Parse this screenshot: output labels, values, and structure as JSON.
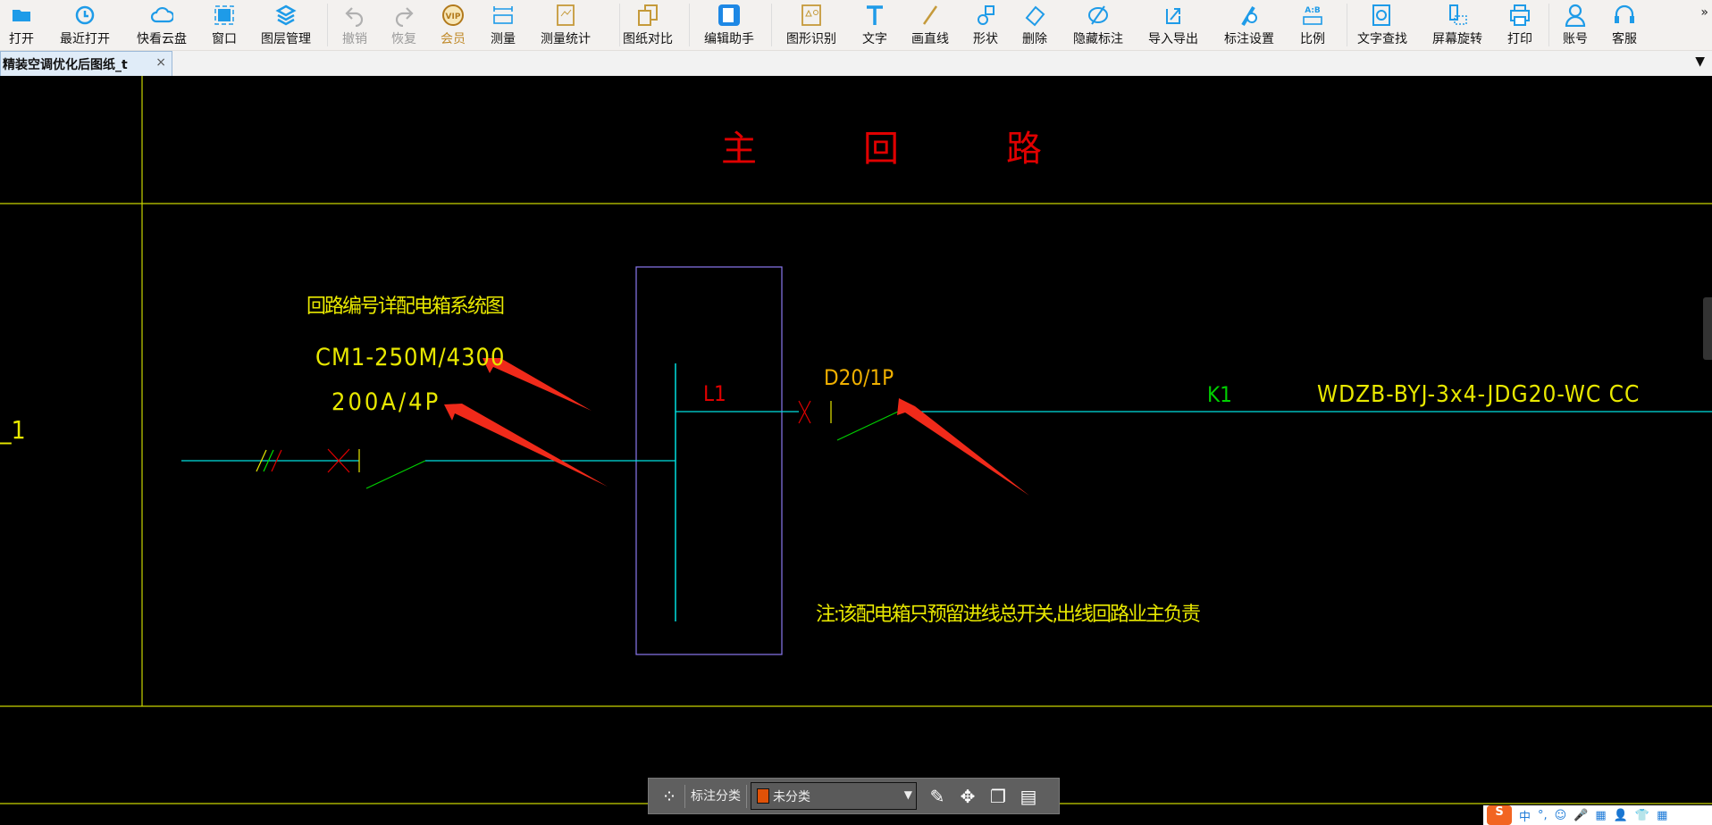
{
  "toolbar": {
    "items": [
      {
        "label": "打开",
        "icon": "folder-open-icon"
      },
      {
        "label": "最近打开",
        "icon": "recent-icon"
      },
      {
        "label": "快看云盘",
        "icon": "cloud-icon"
      },
      {
        "label": "窗口",
        "icon": "window-icon"
      },
      {
        "label": "图层管理",
        "icon": "layers-icon"
      },
      {
        "label": "撤销",
        "icon": "undo-icon",
        "disabled": true
      },
      {
        "label": "恢复",
        "icon": "redo-icon",
        "disabled": true
      },
      {
        "label": "会员",
        "icon": "vip-icon",
        "vip": true
      },
      {
        "label": "测量",
        "icon": "ruler-icon"
      },
      {
        "label": "测量统计",
        "icon": "measure-stats-icon"
      },
      {
        "label": "图纸对比",
        "icon": "compare-icon"
      },
      {
        "label": "编辑助手",
        "icon": "cad-edit-icon"
      },
      {
        "label": "图形识别",
        "icon": "shape-recognize-icon"
      },
      {
        "label": "文字",
        "icon": "text-icon"
      },
      {
        "label": "画直线",
        "icon": "line-icon"
      },
      {
        "label": "形状",
        "icon": "shapes-icon"
      },
      {
        "label": "删除",
        "icon": "eraser-icon"
      },
      {
        "label": "隐藏标注",
        "icon": "eye-hidden-icon"
      },
      {
        "label": "导入导出",
        "icon": "import-export-icon"
      },
      {
        "label": "标注设置",
        "icon": "annotation-settings-icon"
      },
      {
        "label": "比例",
        "icon": "scale-icon"
      },
      {
        "label": "文字查找",
        "icon": "text-search-icon"
      },
      {
        "label": "屏幕旋转",
        "icon": "rotate-screen-icon"
      },
      {
        "label": "打印",
        "icon": "print-icon"
      },
      {
        "label": "账号",
        "icon": "user-icon"
      },
      {
        "label": "客服",
        "icon": "headset-icon"
      }
    ],
    "more": "»"
  },
  "tab": {
    "title": "精装空调优化后图纸_t",
    "close": "×",
    "menu": "▼"
  },
  "drawing": {
    "title": [
      "主",
      "回",
      "路"
    ],
    "heading": "回路编号详配电箱系统图",
    "breaker_model": "CM1-250M/4300",
    "breaker_rating": "200A/4P",
    "phase": "L1",
    "sub_breaker": "D20/1P",
    "circuit": "K1",
    "cable": "WDZB-BYJ-3x4-JDG20-WC CC",
    "note": "注:该配电箱只预留进线总开关,出线回路业主负责",
    "left_label": "_1"
  },
  "bottombar": {
    "label": "标注分类",
    "selected": "未分类",
    "swatch": "#e05208"
  },
  "ime": {
    "logo": "S",
    "items": [
      "中",
      "°,",
      "☺",
      "🎤",
      "▦",
      "👤",
      "👕",
      "▦"
    ]
  }
}
